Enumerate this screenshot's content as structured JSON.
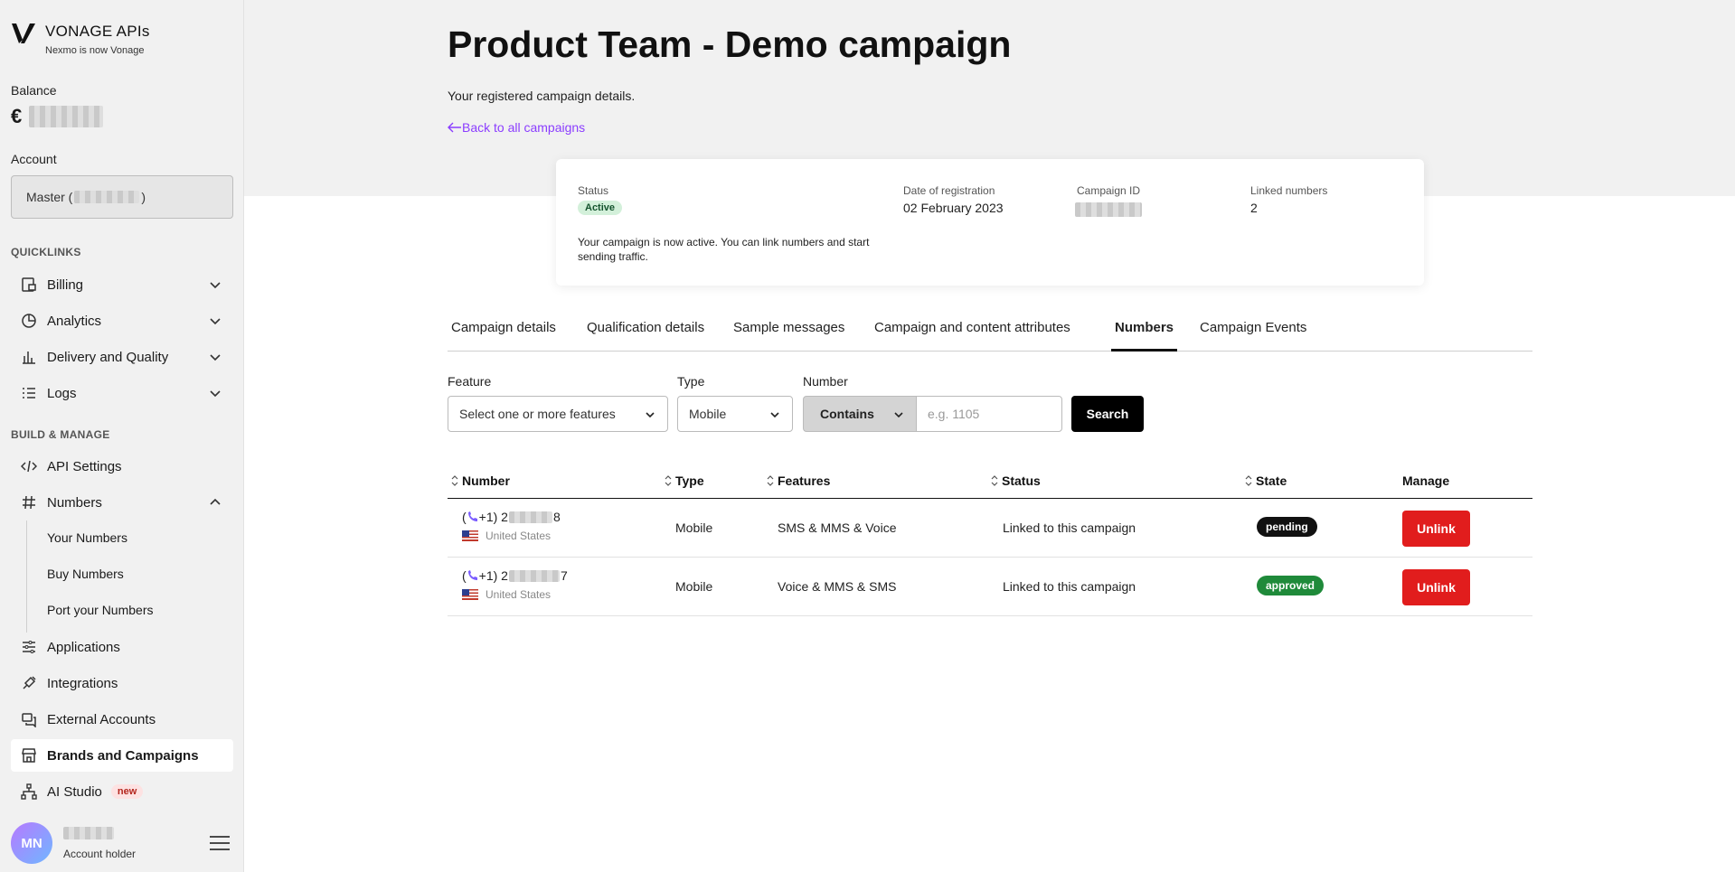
{
  "brand": {
    "title": "VONAGE APIs",
    "subtitle": "Nexmo is now Vonage"
  },
  "sidebar": {
    "balance_label": "Balance",
    "balance_currency": "€",
    "account_label": "Account",
    "account_value_prefix": "Master (",
    "account_value_suffix": ")",
    "quicklinks_head": "QUICKLINKS",
    "quicklinks": [
      {
        "label": "Billing",
        "icon": "billing-icon"
      },
      {
        "label": "Analytics",
        "icon": "analytics-icon"
      },
      {
        "label": "Delivery and Quality",
        "icon": "bar-chart-icon"
      },
      {
        "label": "Logs",
        "icon": "logs-icon"
      }
    ],
    "build_head": "BUILD & MANAGE",
    "api_settings": "API Settings",
    "numbers": "Numbers",
    "numbers_sub": [
      "Your Numbers",
      "Buy Numbers",
      "Port your Numbers"
    ],
    "applications": "Applications",
    "integrations": "Integrations",
    "external_accounts": "External Accounts",
    "brands_campaigns": "Brands and Campaigns",
    "ai_studio": "AI Studio",
    "ai_studio_badge": "new",
    "user_initials": "MN",
    "user_role": "Account holder"
  },
  "header": {
    "title": "Product Team - Demo campaign",
    "description": "Your registered campaign details.",
    "back_link": "Back to all campaigns"
  },
  "summary": {
    "status_label": "Status",
    "status_value": "Active",
    "note": "Your campaign is now active. You can link numbers and start sending traffic.",
    "date_label": "Date of registration",
    "date_value": "02 February 2023",
    "campaign_id_label": "Campaign ID",
    "linked_label": "Linked numbers",
    "linked_value": "2"
  },
  "tabs": [
    "Campaign details",
    "Qualification details",
    "Sample messages",
    "Campaign and content attributes",
    "Numbers",
    "Campaign Events"
  ],
  "active_tab": "Numbers",
  "filters": {
    "feature_label": "Feature",
    "feature_placeholder": "Select one or more features",
    "type_label": "Type",
    "type_value": "Mobile",
    "number_label": "Number",
    "match_value": "Contains",
    "number_placeholder": "e.g. 1105",
    "search_label": "Search"
  },
  "table": {
    "headers": [
      "Number",
      "Type",
      "Features",
      "Status",
      "State",
      "Manage"
    ],
    "rows": [
      {
        "number_prefix": "+1) 2",
        "number_suffix": "8",
        "country": "United States",
        "type": "Mobile",
        "features": "SMS & MMS & Voice",
        "status": "Linked to this campaign",
        "state": "pending",
        "action": "Unlink"
      },
      {
        "number_prefix": "+1) 2",
        "number_suffix": "7",
        "country": "United States",
        "type": "Mobile",
        "features": "Voice & MMS & SMS",
        "status": "Linked to this campaign",
        "state": "approved",
        "action": "Unlink"
      }
    ]
  }
}
